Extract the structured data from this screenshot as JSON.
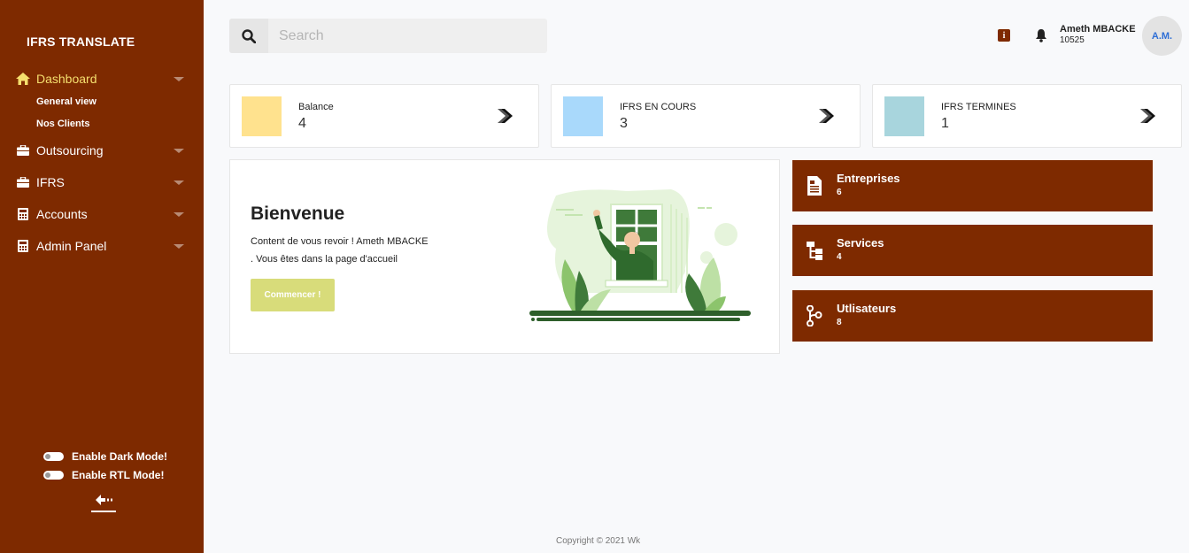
{
  "brand": "IFRS TRANSLATE",
  "nav": {
    "dashboard": "Dashboard",
    "sub_general": "General view",
    "sub_clients": "Nos Clients",
    "outsourcing": "Outsourcing",
    "ifrs": "IFRS",
    "accounts": "Accounts",
    "admin": "Admin Panel"
  },
  "toggles": {
    "dark": "Enable Dark Mode!",
    "rtl": "Enable RTL Mode!"
  },
  "search": {
    "placeholder": "Search"
  },
  "user": {
    "name": "Ameth MBACKE",
    "id": "10525",
    "initials": "A.M."
  },
  "stats": [
    {
      "label": "Balance",
      "value": "4",
      "color": "#ffe28e"
    },
    {
      "label": "IFRS EN COURS",
      "value": "3",
      "color": "#a9d9fb"
    },
    {
      "label": "IFRS TERMINES",
      "value": "1",
      "color": "#a8d5dd"
    }
  ],
  "welcome": {
    "title": "Bienvenue",
    "line1": "Content de vous revoir ! Ameth MBACKE",
    "line2": ". Vous êtes dans la page d'accueil",
    "cta": "Commencer !"
  },
  "tiles": [
    {
      "label": "Entreprises",
      "count": "6",
      "icon": "document-icon"
    },
    {
      "label": "Services",
      "count": "4",
      "icon": "sitemap-icon"
    },
    {
      "label": "Utlisateurs",
      "count": "8",
      "icon": "branch-icon"
    }
  ],
  "footer": "Copyright © 2021 Wk",
  "colors": {
    "sidebar": "#7e2a00",
    "active": "#f5df6e",
    "cta": "#d8dc7a"
  }
}
